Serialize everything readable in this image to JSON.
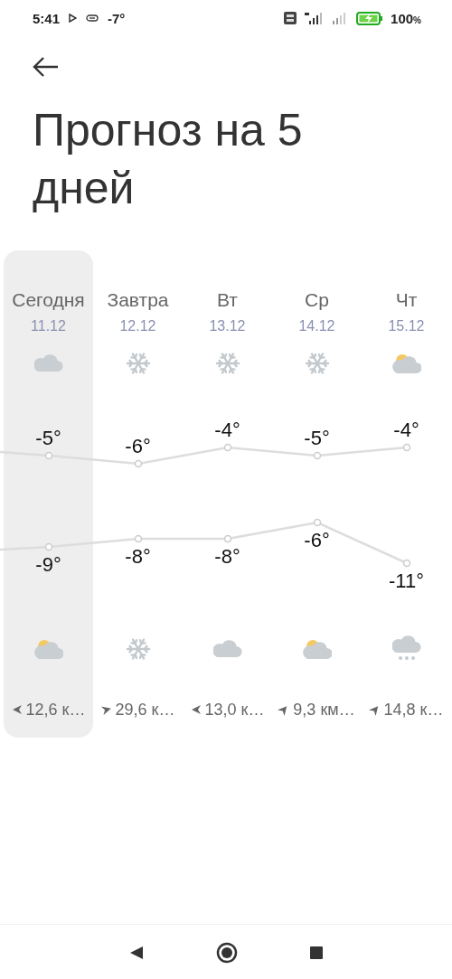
{
  "status_bar": {
    "time": "5:41",
    "temperature": "-7°",
    "battery": "100",
    "battery_unit": "%"
  },
  "title": "Прогноз на 5 дней",
  "days": [
    {
      "name": "Сегодня",
      "date": "11.12",
      "selected": true,
      "day_icon": {
        "kind": "cloud"
      },
      "high": "-5°",
      "low": "-9°",
      "night_icon": {
        "kind": "partly-cloudy"
      },
      "wind_arrow": {
        "kind": "left"
      },
      "wind": "12,6 к…"
    },
    {
      "name": "Завтра",
      "date": "12.12",
      "selected": false,
      "day_icon": {
        "kind": "snow"
      },
      "high": "-6°",
      "low": "-8°",
      "night_icon": {
        "kind": "snow"
      },
      "wind_arrow": {
        "kind": "right"
      },
      "wind": "29,6 к…"
    },
    {
      "name": "Вт",
      "date": "13.12",
      "selected": false,
      "day_icon": {
        "kind": "snow"
      },
      "high": "-4°",
      "low": "-8°",
      "night_icon": {
        "kind": "cloud"
      },
      "wind_arrow": {
        "kind": "left"
      },
      "wind": "13,0 к…"
    },
    {
      "name": "Ср",
      "date": "14.12",
      "selected": false,
      "day_icon": {
        "kind": "snow"
      },
      "high": "-5°",
      "low": "-6°",
      "night_icon": {
        "kind": "partly-cloudy"
      },
      "wind_arrow": {
        "kind": "up-right"
      },
      "wind": "9,3 км…"
    },
    {
      "name": "Чт",
      "date": "15.12",
      "selected": false,
      "day_icon": {
        "kind": "partly-cloudy"
      },
      "high": "-4°",
      "low": "-11°",
      "night_icon": {
        "kind": "cloud-snow"
      },
      "wind_arrow": {
        "kind": "up-right"
      },
      "wind": "14,8 к…"
    }
  ]
}
